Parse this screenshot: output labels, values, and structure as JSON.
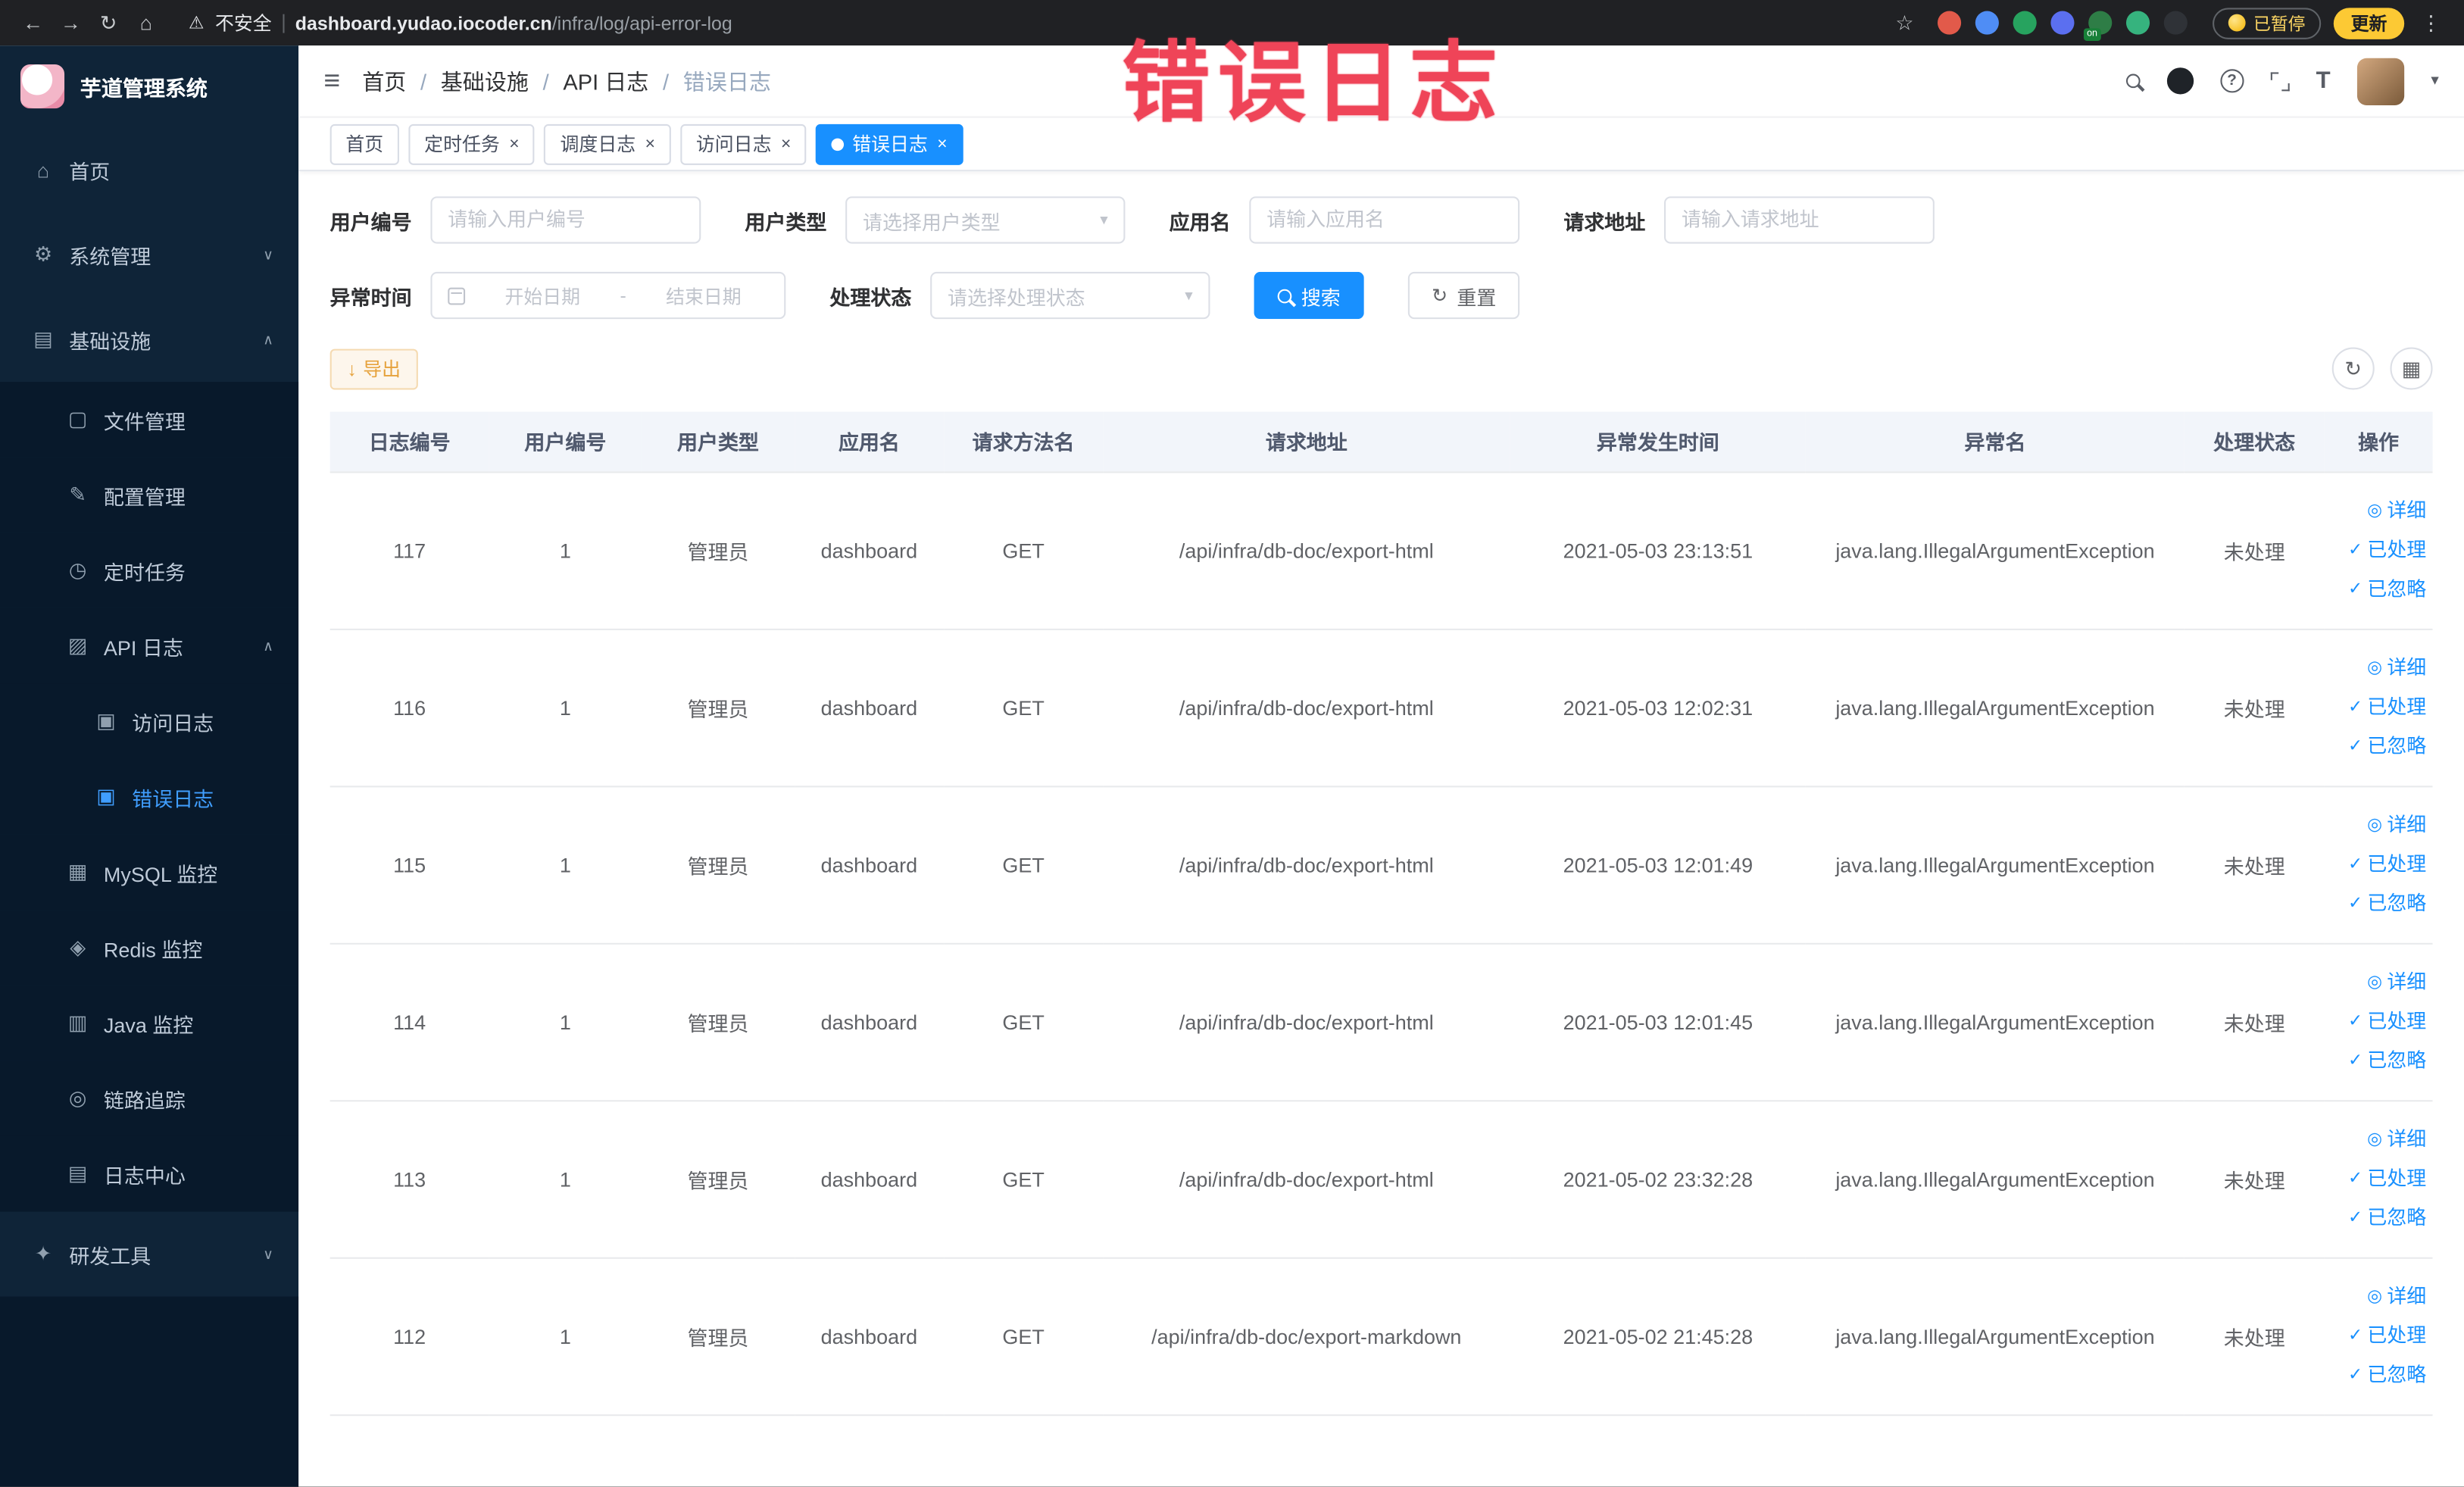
{
  "watermark_text": "错误日志",
  "icons": {
    "back-icon": "←",
    "forward-icon": "→",
    "reload-icon": "↻",
    "home-icon": "⌂",
    "warning-icon": "⚠",
    "star-icon": "☆",
    "kebab-menu-icon": "⋮",
    "hamburger-icon": "≡",
    "caret-down-icon": "▾",
    "gear-icon": "⚙",
    "infra-icon": "▤",
    "folder-icon": "▢",
    "edit-icon": "✎",
    "clock-icon": "◷",
    "api-log-icon": "▨",
    "doc-icon": "▣",
    "grid-icon": "▦",
    "layers-icon": "◈",
    "monitor-icon": "▥",
    "eye-icon": "◎",
    "doc2-icon": "▤",
    "tools-icon": "✦",
    "check-icon": "✓",
    "download-icon": "↓",
    "refresh-icon": "↻",
    "columns-icon": "▦",
    "help-icon": "?",
    "font-size-icon": "T"
  },
  "browser": {
    "security_label": "不安全",
    "url_host": "dashboard.yudao.iocoder.cn",
    "url_path": "/infra/log/api-error-log",
    "extensions": [
      {
        "color": "#e25a4a"
      },
      {
        "color": "#4f8df5"
      },
      {
        "color": "#27a35f"
      },
      {
        "color": "#5b6ff0"
      },
      {
        "color": "#2e7d46",
        "badge": "on"
      },
      {
        "color": "#36b37e"
      },
      {
        "color": "#2f3237"
      }
    ],
    "paused_badge": "已暂停",
    "update_label": "更新"
  },
  "sidebar": {
    "logo_title": "芋道管理系统",
    "menu": [
      {
        "key": "home",
        "label": "首页",
        "icon": "home-icon",
        "level": 1
      },
      {
        "key": "system",
        "label": "系统管理",
        "icon": "gear-icon",
        "level": 1,
        "arrow": "down"
      },
      {
        "key": "infra",
        "label": "基础设施",
        "icon": "infra-icon",
        "level": 1,
        "arrow": "up"
      },
      {
        "key": "file",
        "label": "文件管理",
        "icon": "folder-icon",
        "level": 2
      },
      {
        "key": "config",
        "label": "配置管理",
        "icon": "edit-icon",
        "level": 2
      },
      {
        "key": "job",
        "label": "定时任务",
        "icon": "clock-icon",
        "level": 2
      },
      {
        "key": "api-log",
        "label": "API 日志",
        "icon": "api-log-icon",
        "level": 2,
        "arrow": "up"
      },
      {
        "key": "access-log",
        "label": "访问日志",
        "icon": "doc-icon",
        "level": 3
      },
      {
        "key": "error-log",
        "label": "错误日志",
        "icon": "doc-icon",
        "level": 3,
        "active": true
      },
      {
        "key": "mysql",
        "label": "MySQL 监控",
        "icon": "grid-icon",
        "level": 2
      },
      {
        "key": "redis",
        "label": "Redis 监控",
        "icon": "layers-icon",
        "level": 2
      },
      {
        "key": "java",
        "label": "Java 监控",
        "icon": "monitor-icon",
        "level": 2
      },
      {
        "key": "trace",
        "label": "链路追踪",
        "icon": "eye-icon",
        "level": 2
      },
      {
        "key": "log-center",
        "label": "日志中心",
        "icon": "doc2-icon",
        "level": 2
      },
      {
        "key": "dev-tools",
        "label": "研发工具",
        "icon": "tools-icon",
        "level": 1,
        "arrow": "down"
      }
    ]
  },
  "breadcrumb": [
    "首页",
    "基础设施",
    "API 日志",
    "错误日志"
  ],
  "tabs": [
    {
      "key": "home",
      "label": "首页",
      "closable": false
    },
    {
      "key": "job",
      "label": "定时任务",
      "closable": true
    },
    {
      "key": "job-log",
      "label": "调度日志",
      "closable": true
    },
    {
      "key": "access-log",
      "label": "访问日志",
      "closable": true
    },
    {
      "key": "error-log",
      "label": "错误日志",
      "closable": true,
      "active": true
    }
  ],
  "filters": {
    "user_id_label": "用户编号",
    "user_id_placeholder": "请输入用户编号",
    "user_type_label": "用户类型",
    "user_type_placeholder": "请选择用户类型",
    "app_name_label": "应用名",
    "app_name_placeholder": "请输入应用名",
    "request_url_label": "请求地址",
    "request_url_placeholder": "请输入请求地址",
    "exception_time_label": "异常时间",
    "date_start_placeholder": "开始日期",
    "date_separator": "-",
    "date_end_placeholder": "结束日期",
    "process_status_label": "处理状态",
    "process_status_placeholder": "请选择处理状态",
    "search_label": "搜索",
    "reset_label": "重置"
  },
  "toolbar": {
    "export_label": "导出"
  },
  "table": {
    "columns": [
      "日志编号",
      "用户编号",
      "用户类型",
      "应用名",
      "请求方法名",
      "请求地址",
      "异常发生时间",
      "异常名",
      "处理状态",
      "操作"
    ],
    "row_keys": [
      "id",
      "user_id",
      "user_type",
      "app",
      "method",
      "url",
      "time",
      "exception",
      "status"
    ],
    "rows": [
      {
        "id": "117",
        "user_id": "1",
        "user_type": "管理员",
        "app": "dashboard",
        "method": "GET",
        "url": "/api/infra/db-doc/export-html",
        "time": "2021-05-03 23:13:51",
        "exception": "java.lang.IllegalArgumentException",
        "status": "未处理"
      },
      {
        "id": "116",
        "user_id": "1",
        "user_type": "管理员",
        "app": "dashboard",
        "method": "GET",
        "url": "/api/infra/db-doc/export-html",
        "time": "2021-05-03 12:02:31",
        "exception": "java.lang.IllegalArgumentException",
        "status": "未处理"
      },
      {
        "id": "115",
        "user_id": "1",
        "user_type": "管理员",
        "app": "dashboard",
        "method": "GET",
        "url": "/api/infra/db-doc/export-html",
        "time": "2021-05-03 12:01:49",
        "exception": "java.lang.IllegalArgumentException",
        "status": "未处理"
      },
      {
        "id": "114",
        "user_id": "1",
        "user_type": "管理员",
        "app": "dashboard",
        "method": "GET",
        "url": "/api/infra/db-doc/export-html",
        "time": "2021-05-03 12:01:45",
        "exception": "java.lang.IllegalArgumentException",
        "status": "未处理"
      },
      {
        "id": "113",
        "user_id": "1",
        "user_type": "管理员",
        "app": "dashboard",
        "method": "GET",
        "url": "/api/infra/db-doc/export-html",
        "time": "2021-05-02 23:32:28",
        "exception": "java.lang.IllegalArgumentException",
        "status": "未处理"
      },
      {
        "id": "112",
        "user_id": "1",
        "user_type": "管理员",
        "app": "dashboard",
        "method": "GET",
        "url": "/api/infra/db-doc/export-markdown",
        "time": "2021-05-02 21:45:28",
        "exception": "java.lang.IllegalArgumentException",
        "status": "未处理"
      }
    ],
    "actions": [
      {
        "key": "detail",
        "label": "详细",
        "icon": "eye-icon"
      },
      {
        "key": "processed",
        "label": "已处理",
        "icon": "check-icon"
      },
      {
        "key": "ignored",
        "label": "已忽略",
        "icon": "check-icon"
      }
    ]
  }
}
